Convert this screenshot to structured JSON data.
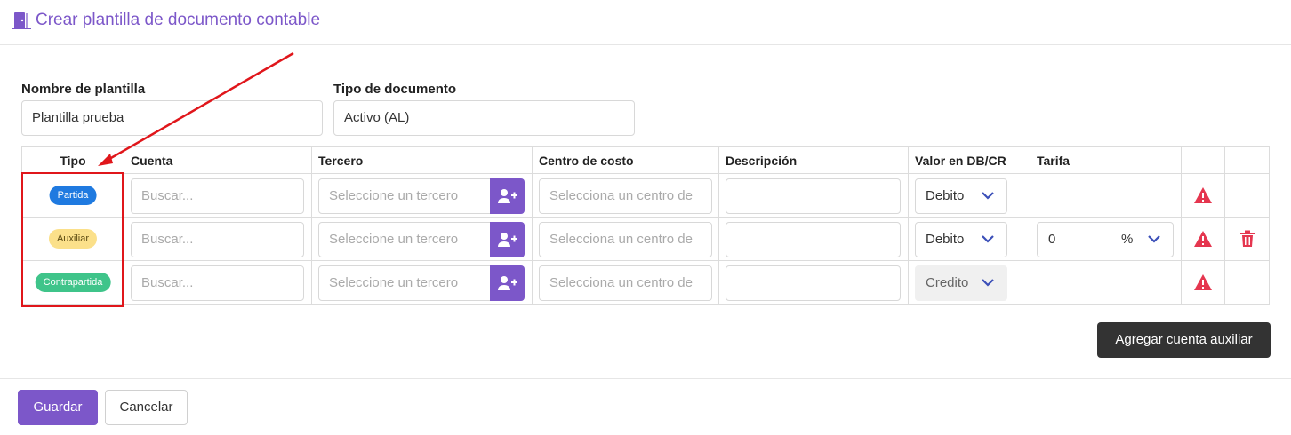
{
  "header": {
    "title": "Crear plantilla de documento contable",
    "icon": "door-icon",
    "accent": "#7c57c9"
  },
  "form": {
    "name_label": "Nombre de plantilla",
    "name_value": "Plantilla prueba",
    "type_label": "Tipo de documento",
    "type_value": "Activo (AL)"
  },
  "table": {
    "headers": [
      "Tipo",
      "Cuenta",
      "Tercero",
      "Centro de costo",
      "Descripción",
      "Valor en DB/CR",
      "Tarifa",
      "",
      ""
    ],
    "rows": [
      {
        "tipo": "Partida",
        "tipo_color": "#1f7ae0",
        "cuenta_placeholder": "Buscar...",
        "tercero_placeholder": "Seleccione un tercero",
        "centro_placeholder": "Selecciona un centro de",
        "descripcion": "",
        "valor": "Debito",
        "tarifa_value": "",
        "tarifa_unit": ""
      },
      {
        "tipo": "Auxiliar",
        "tipo_color": "#fbe08a",
        "cuenta_placeholder": "Buscar...",
        "tercero_placeholder": "Seleccione un tercero",
        "centro_placeholder": "Selecciona un centro de",
        "descripcion": "",
        "valor": "Debito",
        "tarifa_value": "0",
        "tarifa_unit": "%"
      },
      {
        "tipo": "Contrapartida",
        "tipo_color": "#3fc48a",
        "cuenta_placeholder": "Buscar...",
        "tercero_placeholder": "Seleccione un tercero",
        "centro_placeholder": "Selecciona un centro de",
        "descripcion": "",
        "valor": "Credito",
        "tarifa_value": "",
        "tarifa_unit": ""
      }
    ]
  },
  "buttons": {
    "add_aux": "Agregar cuenta auxiliar",
    "save": "Guardar",
    "cancel": "Cancelar"
  },
  "annotation": {
    "highlight_color": "#e0161b"
  }
}
